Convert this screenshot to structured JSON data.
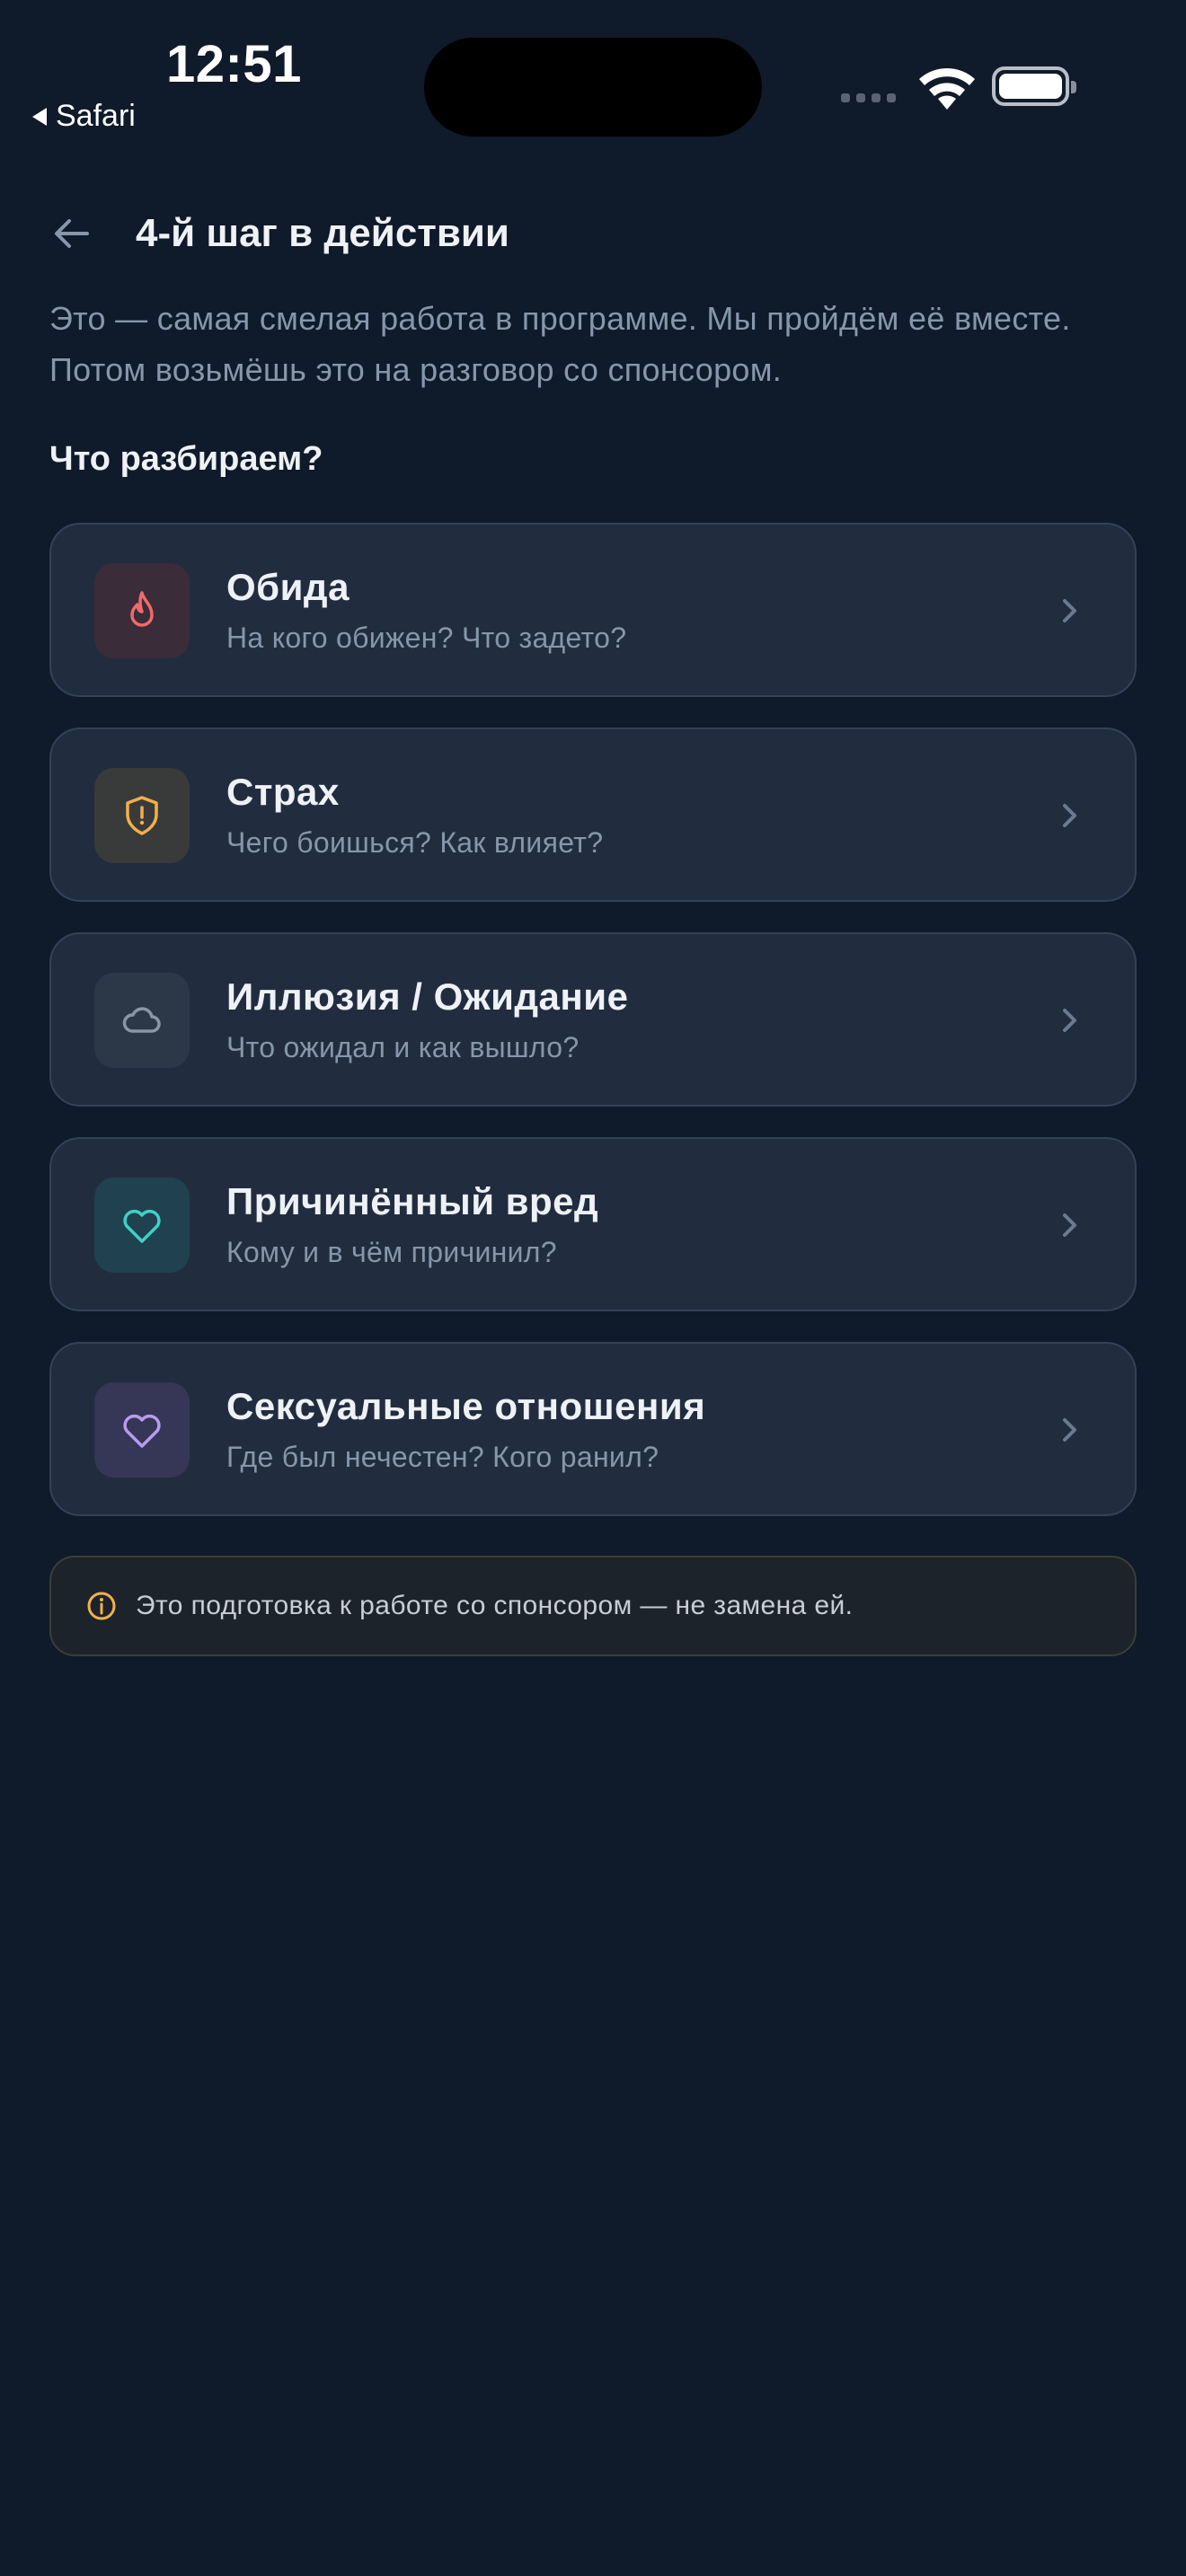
{
  "status_bar": {
    "time": "12:51",
    "back_app": "Safari"
  },
  "header": {
    "title": "4-й шаг в действии",
    "back_icon": "arrow-left-icon"
  },
  "intro": "Это — самая смелая работа в программе. Мы пройдём её вместе. Потом возьмёшь это на разговор со спонсором.",
  "section_title": "Что разбираем?",
  "cards": [
    {
      "title": "Обида",
      "subtitle": "На кого обижен? Что задето?",
      "icon": "flame-icon",
      "icon_color": "#f06a6a",
      "icon_bg": "#3a2c38"
    },
    {
      "title": "Страх",
      "subtitle": "Чего боишься? Как влияет?",
      "icon": "shield-alert-icon",
      "icon_color": "#f2b04a",
      "icon_bg": "#393a3a"
    },
    {
      "title": "Иллюзия / Ожидание",
      "subtitle": "Что ожидал и как вышло?",
      "icon": "cloud-icon",
      "icon_color": "#8a96a6",
      "icon_bg": "#2c3848"
    },
    {
      "title": "Причинённый вред",
      "subtitle": "Кому и в чём причинил?",
      "icon": "heart-icon",
      "icon_color": "#3fd1c6",
      "icon_bg": "#1f4150"
    },
    {
      "title": "Сексуальные отношения",
      "subtitle": "Где был нечестен? Кого ранил?",
      "icon": "heart-icon",
      "icon_color": "#b89cf0",
      "icon_bg": "#363656"
    }
  ],
  "note": {
    "icon": "info-icon",
    "icon_color": "#f2b04a",
    "text": "Это подготовка к работе со спонсором — не замена ей."
  }
}
